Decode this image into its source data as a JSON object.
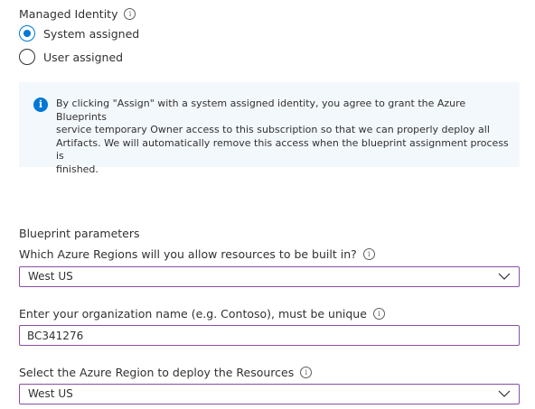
{
  "managed_identity": {
    "label": "Managed Identity",
    "info_icon": "info-icon",
    "options": [
      {
        "label": "System assigned",
        "selected": true
      },
      {
        "label": "User assigned",
        "selected": false
      }
    ]
  },
  "notice": {
    "icon": "info-filled-icon",
    "lines": [
      "By clicking \"Assign\" with a system assigned identity, you agree to grant the Azure Blueprints",
      "service temporary Owner access to this subscription so that we can properly deploy all",
      "Artifacts. We will automatically remove this access when the blueprint assignment process is",
      "finished."
    ]
  },
  "blueprint_parameters": {
    "heading": "Blueprint parameters",
    "fields": [
      {
        "label": "Which Azure Regions will you allow resources to be built in?",
        "value": "West US",
        "type": "dropdown"
      },
      {
        "label": "Enter your organization name (e.g. Contoso), must be unique",
        "value": "BC341276",
        "type": "text"
      },
      {
        "label": "Select the Azure Region to deploy the Resources",
        "value": "West US",
        "type": "dropdown"
      }
    ]
  },
  "colors": {
    "accent": "#0078d4",
    "field_border": "#8a4fa8",
    "notice_background": "#f3f8fd",
    "text": "#323130"
  }
}
